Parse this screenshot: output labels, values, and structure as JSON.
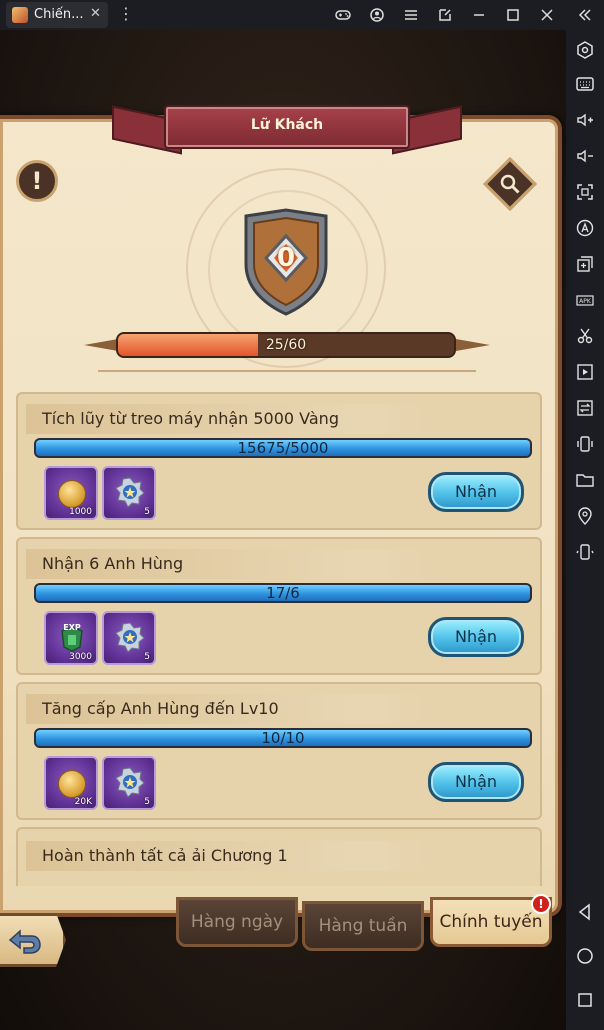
{
  "window": {
    "tab_title": "Chiến...",
    "tab_close": "✕",
    "kebab": "⋮"
  },
  "titlebar_buttons": [
    "gamepad-icon",
    "account-icon",
    "menu-icon",
    "popout-icon",
    "minimize-icon",
    "maximize-icon",
    "close-icon",
    "collapse-sidebar-icon"
  ],
  "sidebar_buttons": [
    "settings-icon",
    "keyboard-icon",
    "volume-up-icon",
    "volume-down-icon",
    "screenshot-icon",
    "macro-icon",
    "multi-instance-icon",
    "apk-icon",
    "scissors-icon",
    "media-icon",
    "sync-icon",
    "shake-icon",
    "folder-icon",
    "location-icon",
    "rotate-icon",
    "android-back-icon",
    "android-home-icon",
    "android-recents-icon"
  ],
  "panel": {
    "title": "Lữ Khách",
    "info_icon": "!",
    "rank_value": "0",
    "xp_text": "25/60",
    "xp_fraction": 0.4167
  },
  "quests": [
    {
      "title": "Tích lũy từ treo máy nhận 5000 Vàng",
      "progress": "15675/5000",
      "fraction": 1.0,
      "rewards": [
        {
          "icon": "gold-coin-icon",
          "count": "1000"
        },
        {
          "icon": "medal-badge-icon",
          "count": "5"
        }
      ],
      "button": "Nhận"
    },
    {
      "title": "Nhận 6 Anh Hùng",
      "progress": "17/6",
      "fraction": 1.0,
      "rewards": [
        {
          "icon": "exp-icon",
          "label": "EXP",
          "count": "3000"
        },
        {
          "icon": "medal-badge-icon",
          "count": "5"
        }
      ],
      "button": "Nhận"
    },
    {
      "title": "Tăng cấp Anh Hùng đến Lv10",
      "progress": "10/10",
      "fraction": 1.0,
      "rewards": [
        {
          "icon": "gold-coin-icon",
          "count": "20K"
        },
        {
          "icon": "medal-badge-icon",
          "count": "5"
        }
      ],
      "button": "Nhận"
    },
    {
      "title": "Hoàn thành tất cả ải Chương 1"
    }
  ],
  "tabs": [
    {
      "label": "Hàng ngày",
      "active": false
    },
    {
      "label": "Hàng tuần",
      "active": false
    },
    {
      "label": "Chính tuyến",
      "active": true,
      "notification": "!"
    }
  ],
  "colors": {
    "accent_blue": "#2f93e0",
    "xp_orange": "#e0552a",
    "ribbon_red": "#a8414a",
    "parchment": "#f4e7cb"
  }
}
